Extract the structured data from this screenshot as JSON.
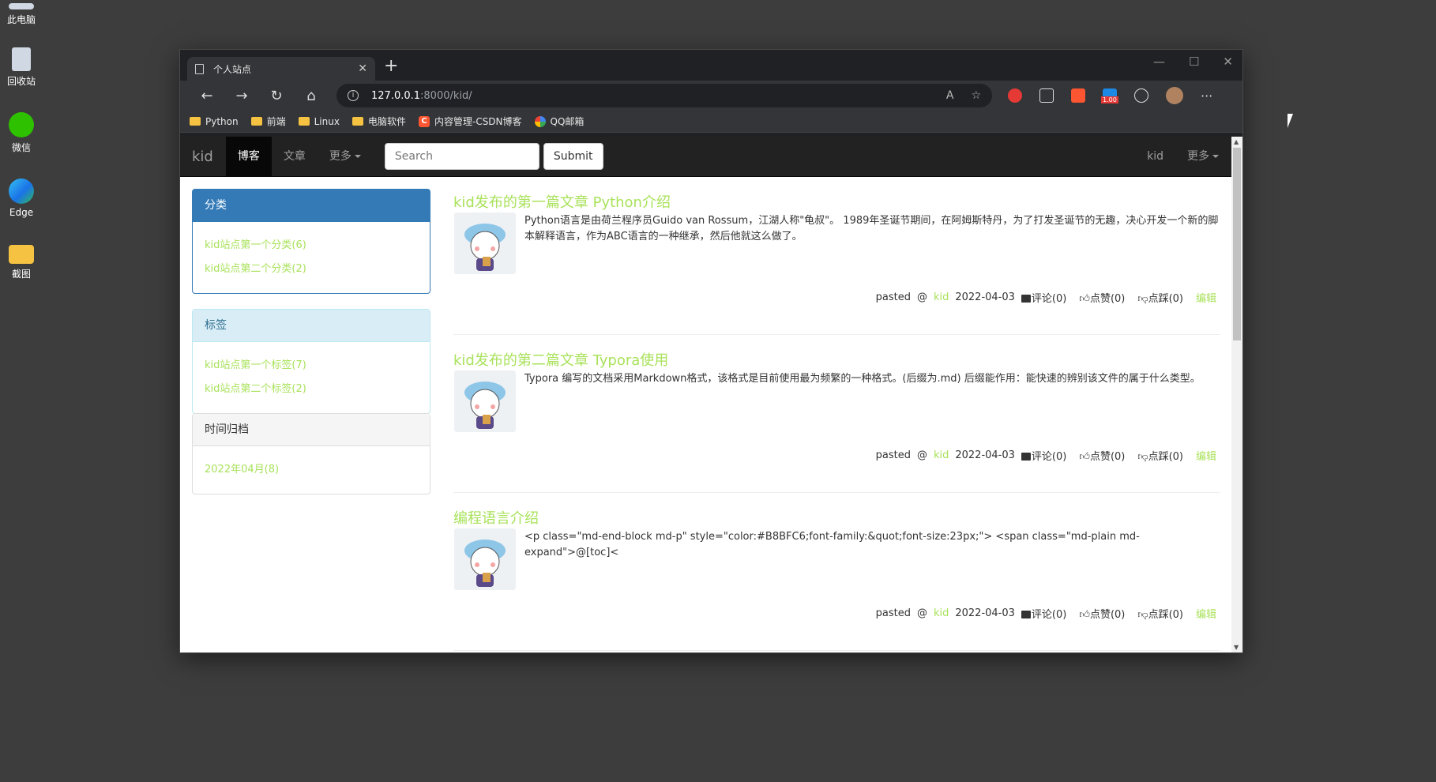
{
  "desktop": {
    "icons": [
      {
        "label": "此电脑",
        "icon": "computer-icon"
      },
      {
        "label": "回收站",
        "icon": "recycle-bin-icon"
      },
      {
        "label": "微信",
        "icon": "wechat-icon"
      },
      {
        "label": "Edge",
        "icon": "edge-icon"
      },
      {
        "label": "截图",
        "icon": "folder-icon"
      }
    ]
  },
  "browser": {
    "tab_title": "个人站点",
    "url_host": "127.0.0.1",
    "url_path": ":8000/kid/",
    "bookmarks": [
      {
        "label": "Python",
        "icon": "folder-icon"
      },
      {
        "label": "前端",
        "icon": "folder-icon"
      },
      {
        "label": "Linux",
        "icon": "folder-icon"
      },
      {
        "label": "电脑软件",
        "icon": "folder-icon"
      },
      {
        "label": "内容管理-CSDN博客",
        "icon": "csdn-icon"
      },
      {
        "label": "QQ邮箱",
        "icon": "qq-mail-icon"
      }
    ],
    "ext_badge": "1.00"
  },
  "navbar": {
    "brand": "kid",
    "items": [
      "博客",
      "文章",
      "更多"
    ],
    "search_placeholder": "Search",
    "submit_label": "Submit",
    "user": "kid",
    "right_more": "更多"
  },
  "sidebar": {
    "category": {
      "title": "分类",
      "items": [
        "kid站点第一个分类(6)",
        "kid站点第二个分类(2)"
      ]
    },
    "tags": {
      "title": "标签",
      "items": [
        "kid站点第一个标签(7)",
        "kid站点第二个标签(2)"
      ]
    },
    "archive": {
      "title": "时间归档",
      "items": [
        "2022年04月(8)"
      ]
    }
  },
  "articles": [
    {
      "title": "kid发布的第一篇文章 Python介绍",
      "desc": "Python语言是由荷兰程序员Guido van Rossum，江湖人称\"龟叔\"。 1989年圣诞节期间，在阿姆斯特丹，为了打发圣诞节的无趣，决心开发一个新的脚本解释语言，作为ABC语言的一种继承，然后他就这么做了。",
      "meta": {
        "prefix": "pasted",
        "at": "@",
        "author": "kid",
        "date": "2022-04-03",
        "comment": "评论(0)",
        "up": "点赞(0)",
        "down": "点踩(0)",
        "edit": "编辑"
      }
    },
    {
      "title": "kid发布的第二篇文章 Typora使用",
      "desc": "Typora 编写的文档采用Markdown格式，该格式是目前使用最为频繁的一种格式。(后缀为.md) 后缀能作用：能快速的辨别该文件的属于什么类型。",
      "meta": {
        "prefix": "pasted",
        "at": "@",
        "author": "kid",
        "date": "2022-04-03",
        "comment": "评论(0)",
        "up": "点赞(0)",
        "down": "点踩(0)",
        "edit": "编辑"
      }
    },
    {
      "title": "编程语言介绍",
      "desc": "<p class=\"md-end-block md-p\" style=\"color:#B8BFC6;font-family:&quot;font-size:23px;\"> <span class=\"md-plain md-expand\">@[toc]<",
      "meta": {
        "prefix": "pasted",
        "at": "@",
        "author": "kid",
        "date": "2022-04-03",
        "comment": "评论(0)",
        "up": "点赞(0)",
        "down": "点踩(0)",
        "edit": "编辑"
      }
    }
  ],
  "colors": {
    "link_green": "#a9e25b",
    "primary": "#337ab7",
    "navbar_bg": "#222222"
  }
}
